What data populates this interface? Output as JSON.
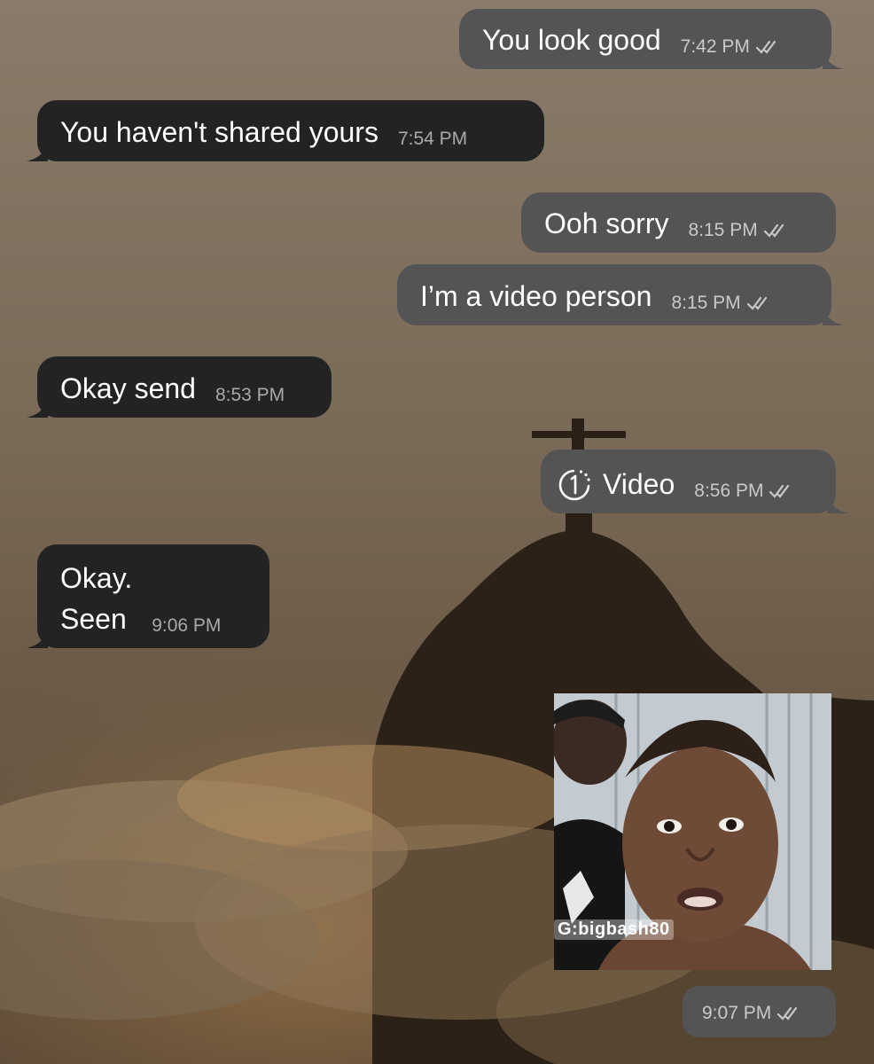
{
  "chat": {
    "messages": [
      {
        "direction": "outgoing",
        "text": "You look good",
        "time": "7:42 PM",
        "read": true
      },
      {
        "direction": "incoming",
        "text": "You haven't shared yours",
        "time": "7:54 PM"
      },
      {
        "direction": "outgoing",
        "text": "Ooh sorry",
        "time": "8:15 PM",
        "read": true
      },
      {
        "direction": "outgoing",
        "text": "I’m a video person",
        "time": "8:15 PM",
        "read": true
      },
      {
        "direction": "incoming",
        "text": "Okay send",
        "time": "8:53 PM"
      },
      {
        "direction": "outgoing",
        "type": "view-once-video",
        "icon": "view-once-icon",
        "text": "Video",
        "time": "8:56 PM",
        "read": true
      },
      {
        "direction": "incoming",
        "text": "Okay.\nSeen",
        "time": "9:06 PM"
      },
      {
        "direction": "outgoing",
        "type": "video-thumbnail",
        "watermark": "G:bigbash80",
        "time": "9:07 PM",
        "read": true
      }
    ]
  },
  "colors": {
    "incoming_bubble": "#232323",
    "outgoing_bubble": "#545454",
    "timestamp": "#c9c9c9"
  },
  "icons": {
    "read_receipt": "double-check-icon",
    "view_once": "view-once-icon"
  }
}
